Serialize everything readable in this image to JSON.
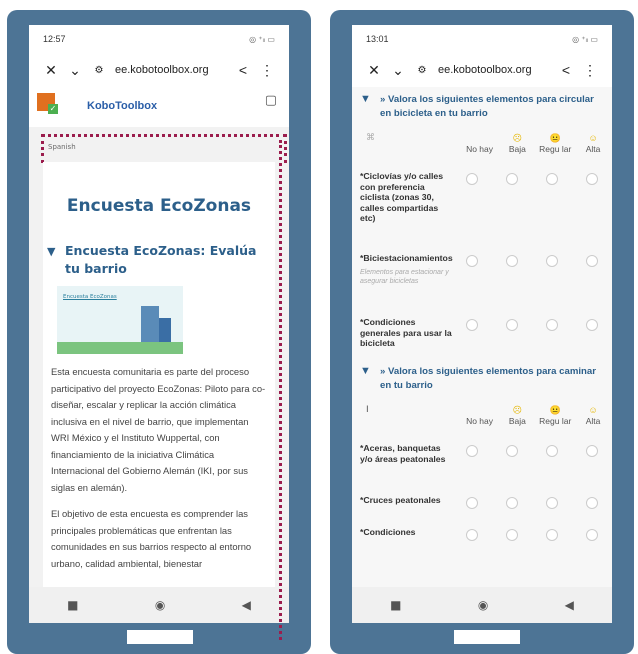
{
  "left_phone": {
    "status": {
      "time": "12:57",
      "icons_right": "◎ ⁺ₗₗ ▭"
    },
    "url": "ee.kobotoolbox.org",
    "kobo_name": "KoboToolbox",
    "language": "Spanish",
    "form_title": "Encuesta EcoZonas",
    "group_title": "Encuesta EcoZonas: Evalúa tu barrio",
    "banner": {
      "title": "Encuesta EcoZonas"
    },
    "paragraph1": "Esta encuesta comunitaria es parte del proceso participativo del proyecto EcoZonas: Piloto para co-diseñar, escalar y replicar la acción climática inclusiva en el nivel de barrio, que implementan WRI México y el Instituto Wuppertal, con financiamiento de la iniciativa Climática Internacional del Gobierno Alemán (IKI, por sus siglas en alemán).",
    "paragraph2": "El objetivo de esta encuesta es comprender las principales problemáticas que enfrentan las comunidades en sus barrios respecto al entorno urbano, calidad ambiental, bienestar"
  },
  "right_phone": {
    "status": {
      "time": "13:01",
      "icons_right": "◎ ⁺ₗₗ ▭"
    },
    "url": "ee.kobotoolbox.org",
    "section1_title": "» Valora los siguientes elementos para circular en bicicleta en tu barrio",
    "section2_title": "» Valora los siguientes elementos para caminar en tu barrio",
    "columns": [
      {
        "label": "No hay",
        "emoji": ""
      },
      {
        "label": "Baja",
        "emoji": "☹"
      },
      {
        "label": "Regu lar",
        "emoji": "😐"
      },
      {
        "label": "Alta",
        "emoji": "☺"
      }
    ],
    "section1_rows": [
      {
        "label": "*Ciclovías y/o calles con preferencia ciclista (zonas 30, calles compartidas etc)",
        "hint": ""
      },
      {
        "label": "*Biciestacionamientos",
        "hint": "Elementos para estacionar y asegurar bicicletas"
      },
      {
        "label": "*Condiciones generales para usar la bicicleta",
        "hint": ""
      }
    ],
    "section2_rows": [
      {
        "label": "*Aceras, banquetas y/o áreas peatonales",
        "hint": ""
      },
      {
        "label": "*Cruces peatonales",
        "hint": ""
      },
      {
        "label": "*Condiciones",
        "hint": ""
      }
    ]
  },
  "colors": {
    "frame": "#4d7495",
    "accent": "#2c5f8a",
    "dotted_outline": "#9b1d4d"
  },
  "icons": {
    "close": "close-icon",
    "chevron": "chevron-down-icon",
    "share": "share-icon",
    "menu": "kebab-menu-icon"
  }
}
